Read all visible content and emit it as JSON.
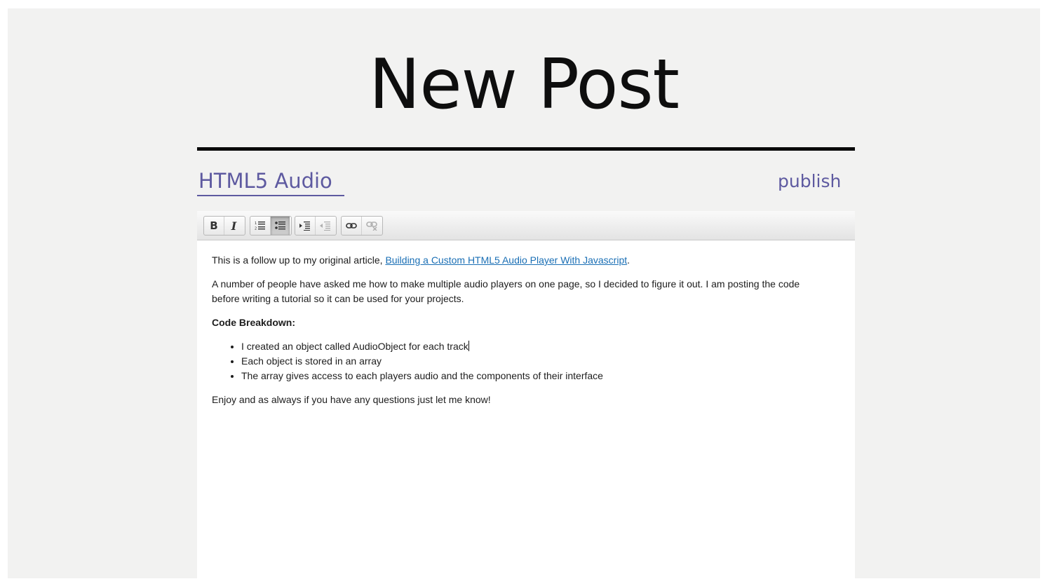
{
  "page": {
    "title": "New Post"
  },
  "post": {
    "title_value": "HTML5 Audio",
    "publish_label": "publish"
  },
  "toolbar": {
    "bold": "B",
    "italic": "I",
    "buttons": [
      {
        "name": "bold",
        "icon": "bold-icon"
      },
      {
        "name": "italic",
        "icon": "italic-icon"
      },
      {
        "name": "ordered-list",
        "icon": "ordered-list-icon"
      },
      {
        "name": "unordered-list",
        "icon": "unordered-list-icon",
        "active": true
      },
      {
        "name": "indent",
        "icon": "indent-icon"
      },
      {
        "name": "outdent",
        "icon": "outdent-icon",
        "disabled": true
      },
      {
        "name": "link",
        "icon": "link-icon"
      },
      {
        "name": "unlink",
        "icon": "unlink-icon",
        "disabled": true
      }
    ]
  },
  "body": {
    "intro_text": "This is a follow up to my original article, ",
    "intro_link": "Building a Custom HTML5 Audio Player With Javascript",
    "intro_end": ".",
    "paragraph2": "A number of people have asked me how to make multiple audio players on one page, so I decided to figure it out. I am posting the code before writing a tutorial so it can be used for your projects.",
    "heading": "Code Breakdown:",
    "bullets": [
      "I created an object called AudioObject for each track",
      "Each object is stored in an array",
      "The array gives access to each players audio and the components of their interface"
    ],
    "closing": "Enjoy and as always if you have any questions just let me know!"
  },
  "colors": {
    "accent": "#5e5aa0",
    "link": "#1a6fb5",
    "background": "#f2f2f1"
  }
}
